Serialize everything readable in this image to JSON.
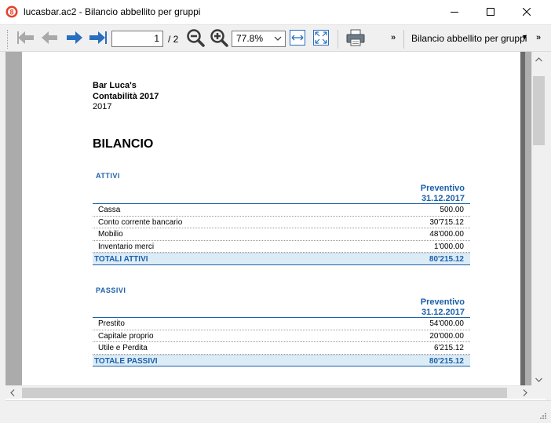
{
  "window": {
    "title": "lucasbar.ac2 - Bilancio abbellito per gruppi"
  },
  "toolbar": {
    "page_current": "1",
    "page_total": "/ 2",
    "zoom": "77.8%",
    "more_label": "»",
    "report_name": "Bilancio abbellito per gruppi",
    "report_more": "»"
  },
  "report": {
    "company": "Bar Luca's",
    "subtitle": "Contabilità 2017",
    "year": "2017",
    "title": "BILANCIO",
    "attivi": {
      "section": "ATTIVI",
      "col_head_1": "Preventivo",
      "col_head_2": "31.12.2017",
      "rows": [
        {
          "label": "Cassa",
          "value": "500.00"
        },
        {
          "label": "Conto corrente bancario",
          "value": "30'715.12"
        },
        {
          "label": "Mobilio",
          "value": "48'000.00"
        },
        {
          "label": "Inventario merci",
          "value": "1'000.00"
        }
      ],
      "total": {
        "label": "TOTALI ATTIVI",
        "value": "80'215.12"
      }
    },
    "passivi": {
      "section": "PASSIVI",
      "col_head_1": "Preventivo",
      "col_head_2": "31.12.2017",
      "rows": [
        {
          "label": "Prestito",
          "value": "54'000.00"
        },
        {
          "label": "Capitale proprio",
          "value": "20'000.00"
        },
        {
          "label": "Utile e Perdita",
          "value": "6'215.12"
        }
      ],
      "total": {
        "label": "TOTALE PASSIVI",
        "value": "80'215.12"
      }
    }
  },
  "colors": {
    "accent_blue": "#1a5fa8",
    "total_row_bg": "#dcecf7",
    "nav_arrow_disabled": "#a9a9a9",
    "nav_arrow_enabled": "#2a6fbe"
  }
}
